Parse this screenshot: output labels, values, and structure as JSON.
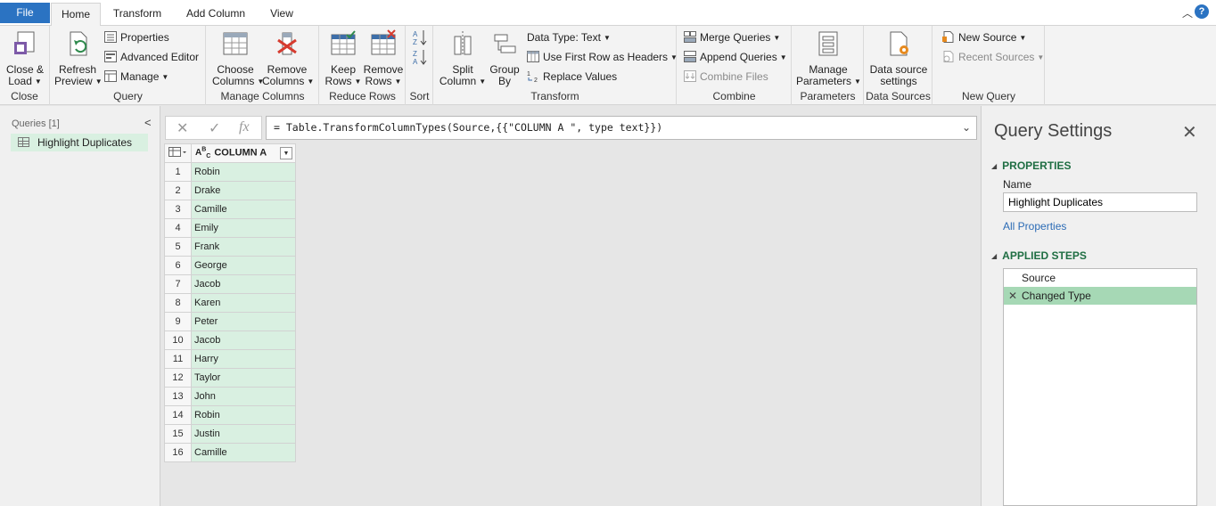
{
  "tabs": {
    "file": "File",
    "home": "Home",
    "transform": "Transform",
    "add_column": "Add Column",
    "view": "View"
  },
  "help": "?",
  "ribbon": {
    "close": {
      "close_load_1": "Close &",
      "close_load_2": "Load",
      "label": "Close"
    },
    "query": {
      "refresh_1": "Refresh",
      "refresh_2": "Preview",
      "properties": "Properties",
      "advanced_editor": "Advanced Editor",
      "manage": "Manage",
      "label": "Query"
    },
    "manage_columns": {
      "choose_1": "Choose",
      "choose_2": "Columns",
      "remove_1": "Remove",
      "remove_2": "Columns",
      "label": "Manage Columns"
    },
    "reduce_rows": {
      "keep_1": "Keep",
      "keep_2": "Rows",
      "remove_1": "Remove",
      "remove_2": "Rows",
      "label": "Reduce Rows"
    },
    "sort": {
      "label": "Sort"
    },
    "transform": {
      "split_1": "Split",
      "split_2": "Column",
      "group_1": "Group",
      "group_2": "By",
      "data_type": "Data Type: Text",
      "first_row": "Use First Row as Headers",
      "replace": "Replace Values",
      "label": "Transform"
    },
    "combine": {
      "merge": "Merge Queries",
      "append": "Append Queries",
      "combine_files": "Combine Files",
      "label": "Combine"
    },
    "parameters": {
      "manage_1": "Manage",
      "manage_2": "Parameters",
      "label": "Parameters"
    },
    "data_sources": {
      "settings_1": "Data source",
      "settings_2": "settings",
      "label": "Data Sources"
    },
    "new_query": {
      "new_source": "New Source",
      "recent_sources": "Recent Sources",
      "label": "New Query"
    }
  },
  "queries_pane": {
    "header": "Queries [1]",
    "items": [
      "Highlight Duplicates"
    ]
  },
  "formula_bar": {
    "formula": "= Table.TransformColumnTypes(Source,{{\"COLUMN A \", type text}})"
  },
  "grid": {
    "column_header": "COLUMN A",
    "type_icon": "ABC",
    "rows": [
      "Robin",
      "Drake",
      "Camille",
      "Emily",
      "Frank",
      "George",
      "Jacob",
      "Karen",
      "Peter",
      "Jacob",
      "Harry",
      "Taylor",
      "John",
      "Robin",
      "Justin",
      "Camille"
    ]
  },
  "settings": {
    "title": "Query Settings",
    "properties_header": "PROPERTIES",
    "name_label": "Name",
    "name_value": "Highlight Duplicates",
    "all_properties": "All Properties",
    "applied_steps_header": "APPLIED STEPS",
    "steps": [
      "Source",
      "Changed Type"
    ]
  }
}
